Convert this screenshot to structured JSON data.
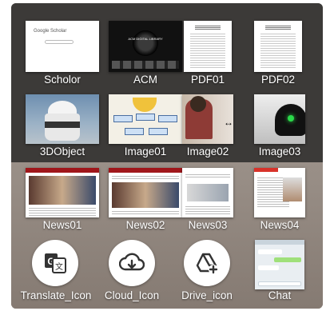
{
  "tiles": {
    "scholar": {
      "label": "Scholor",
      "thumb_text": "Google Scholar"
    },
    "acm": {
      "label": "ACM",
      "thumb_text": "ACM DIGITAL LIBRARY"
    },
    "pdf01": {
      "label": "PDF01"
    },
    "pdf02": {
      "label": "PDF02"
    },
    "object3d": {
      "label": "3DObject"
    },
    "image01": {
      "label": "Image01"
    },
    "image02": {
      "label": "Image02"
    },
    "image03": {
      "label": "Image03"
    },
    "news01": {
      "label": "News01"
    },
    "news02": {
      "label": "News02"
    },
    "news03": {
      "label": "News03"
    },
    "news04": {
      "label": "News04"
    },
    "translate": {
      "label": "Translate_Icon"
    },
    "cloud": {
      "label": "Cloud_Icon"
    },
    "drive": {
      "label": "Drive_icon"
    },
    "chat": {
      "label": "Chat"
    }
  },
  "colors": {
    "top_band": "#3c3a38",
    "bottom_band": "#8a8078",
    "label_text": "#ffffff"
  },
  "icons": {
    "translate": "translate-icon",
    "cloud": "cloud-download-icon",
    "drive": "drive-add-icon"
  }
}
